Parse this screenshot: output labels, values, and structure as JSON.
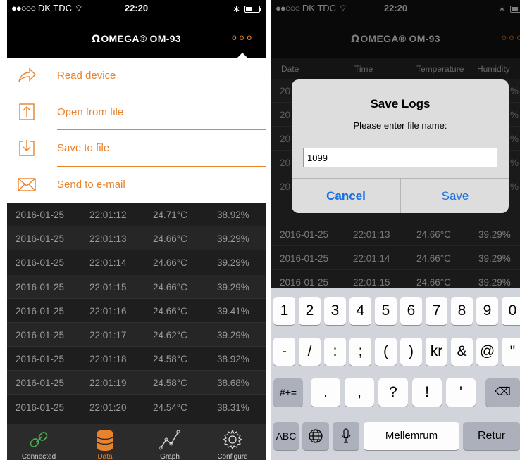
{
  "status_bar": {
    "carrier": "DK TDC",
    "time": "22:20"
  },
  "nav": {
    "logo": "OMEGA",
    "model": "OM-93",
    "more": "ooo"
  },
  "menu": {
    "items": [
      {
        "label": "Read device",
        "icon": "share-arrow-icon"
      },
      {
        "label": "Open from file",
        "icon": "upload-icon"
      },
      {
        "label": "Save to file",
        "icon": "download-icon"
      },
      {
        "label": "Send to e-mail",
        "icon": "envelope-icon"
      }
    ]
  },
  "table": {
    "headers": [
      "Date",
      "Time",
      "Temperature",
      "Humidity"
    ],
    "left_rows": [
      [
        "2016-01-25",
        "22:01:12",
        "24.71°C",
        "38.92%"
      ],
      [
        "2016-01-25",
        "22:01:13",
        "24.66°C",
        "39.29%"
      ],
      [
        "2016-01-25",
        "22:01:14",
        "24.66°C",
        "39.29%"
      ],
      [
        "2016-01-25",
        "22:01:15",
        "24.66°C",
        "39.29%"
      ],
      [
        "2016-01-25",
        "22:01:16",
        "24.66°C",
        "39.41%"
      ],
      [
        "2016-01-25",
        "22:01:17",
        "24.62°C",
        "39.29%"
      ],
      [
        "2016-01-25",
        "22:01:18",
        "24.58°C",
        "38.92%"
      ],
      [
        "2016-01-25",
        "22:01:19",
        "24.58°C",
        "38.68%"
      ],
      [
        "2016-01-25",
        "22:01:20",
        "24.54°C",
        "38.31%"
      ]
    ],
    "right_rows": [
      [
        "2016-01-25",
        "22:01:13",
        "24.66°C",
        "39.29%"
      ],
      [
        "2016-01-25",
        "22:01:14",
        "24.66°C",
        "39.29%"
      ],
      [
        "2016-01-25",
        "22:01:15",
        "24.66°C",
        "39.29%"
      ]
    ],
    "right_partial_values": [
      "%",
      "%",
      "%",
      "%",
      "%"
    ]
  },
  "tabs": [
    {
      "label": "Connected",
      "icon": "link-icon"
    },
    {
      "label": "Data",
      "icon": "database-icon",
      "active": true
    },
    {
      "label": "Graph",
      "icon": "graph-icon"
    },
    {
      "label": "Configure",
      "icon": "gear-icon"
    }
  ],
  "dialog": {
    "title": "Save Logs",
    "message": "Please enter file name:",
    "input_value": "1099",
    "cancel": "Cancel",
    "save": "Save"
  },
  "keyboard": {
    "row1": [
      "1",
      "2",
      "3",
      "4",
      "5",
      "6",
      "7",
      "8",
      "9",
      "0"
    ],
    "row2": [
      "-",
      "/",
      ":",
      ";",
      "(",
      ")",
      "kr",
      "&",
      "@",
      "\""
    ],
    "row3_left": "#+=",
    "row3": [
      ".",
      ",",
      "?",
      "!",
      "'"
    ],
    "abc": "ABC",
    "space": "Mellemrum",
    "return": "Retur"
  },
  "colors": {
    "accent": "#e8822c",
    "ios_blue": "#1a6fe0"
  }
}
